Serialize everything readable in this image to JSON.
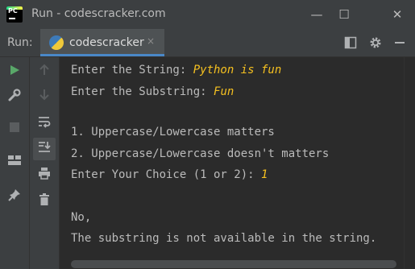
{
  "window": {
    "title": "Run - codescracker.com",
    "app_icon": {
      "text": "PC",
      "name": "pycharm-icon"
    },
    "controls": {
      "minimize": "—",
      "maximize": "☐",
      "close": "✕"
    }
  },
  "run_toolbar": {
    "label": "Run:",
    "tab": {
      "label": "codescracker",
      "close": "×",
      "icon": "python-icon"
    },
    "icons": [
      "layout-icon",
      "gear-icon",
      "minimize-panel-icon"
    ]
  },
  "left_toolbar": {
    "icons": [
      "run-icon",
      "wrench-icon",
      "stop-icon",
      "layout-icon",
      "pin-icon"
    ]
  },
  "second_toolbar": {
    "icons": [
      "up-arrow-icon",
      "down-arrow-icon",
      "soft-wrap-icon",
      "scroll-to-end-icon",
      "print-icon",
      "trash-icon"
    ]
  },
  "console": {
    "lines": [
      {
        "prompt": "Enter the String: ",
        "input": "Python is fun"
      },
      {
        "prompt": "Enter the Substring: ",
        "input": "Fun"
      },
      {
        "prompt": "",
        "input": ""
      },
      {
        "prompt": "1. Uppercase/Lowercase matters",
        "input": ""
      },
      {
        "prompt": "2. Uppercase/Lowercase doesn't matters",
        "input": ""
      },
      {
        "prompt": "Enter Your Choice (1 or 2): ",
        "input": "1"
      },
      {
        "prompt": "",
        "input": ""
      },
      {
        "prompt": "No,",
        "input": ""
      },
      {
        "prompt": "The substring is not available in the string.",
        "input": ""
      }
    ]
  },
  "colors": {
    "background": "#2b2b2b",
    "panel": "#3c3f41",
    "text": "#bbbbbb",
    "input_text": "#f5c020",
    "run_green": "#59a869",
    "accent_blue": "#4a88c7"
  }
}
